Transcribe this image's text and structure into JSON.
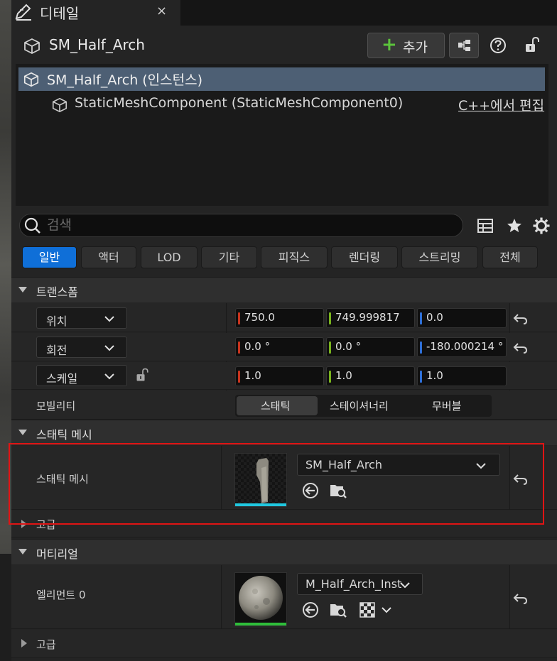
{
  "tab": {
    "title": "디테일",
    "close": "×"
  },
  "header": {
    "actor_name": "SM_Half_Arch",
    "add_label": "추가",
    "add_plus": "+"
  },
  "tree": {
    "root_label": "SM_Half_Arch (인스턴스)",
    "child_label": "StaticMeshComponent (StaticMeshComponent0)",
    "edit_link": "C++에서 편집"
  },
  "search": {
    "placeholder": "검색",
    "value": ""
  },
  "filters": [
    "일반",
    "액터",
    "LOD",
    "기타",
    "피직스",
    "렌더링",
    "스트리밍",
    "전체"
  ],
  "active_filter": "일반",
  "transform": {
    "section_title": "트랜스폼",
    "rows": [
      {
        "mode": "위치",
        "x": "750.0",
        "y": "749.999817",
        "z": "0.0",
        "has_reset": true
      },
      {
        "mode": "회전",
        "x": "0.0 °",
        "y": "0.0 °",
        "z": "-180.000214 °",
        "has_reset": true
      },
      {
        "mode": "스케일",
        "x": "1.0",
        "y": "1.0",
        "z": "1.0",
        "has_reset": false
      }
    ],
    "mobility_label": "모빌리티",
    "mobility_options": [
      "스태틱",
      "스테이셔너리",
      "무버블"
    ],
    "mobility_selected": "스태틱"
  },
  "static_mesh": {
    "section_title": "스태틱 메시",
    "property_label": "스태틱 메시",
    "asset": "SM_Half_Arch",
    "advanced_label": "고급"
  },
  "materials": {
    "section_title": "머티리얼",
    "element_label": "엘리먼트 0",
    "asset": "M_Half_Arch_Inst",
    "advanced_label": "고급"
  },
  "colors": {
    "accent_blue": "#0f6fd8",
    "x_axis": "#c8341e",
    "y_axis": "#78b31e",
    "z_axis": "#2e6fd6",
    "highlight": "#e01414"
  }
}
